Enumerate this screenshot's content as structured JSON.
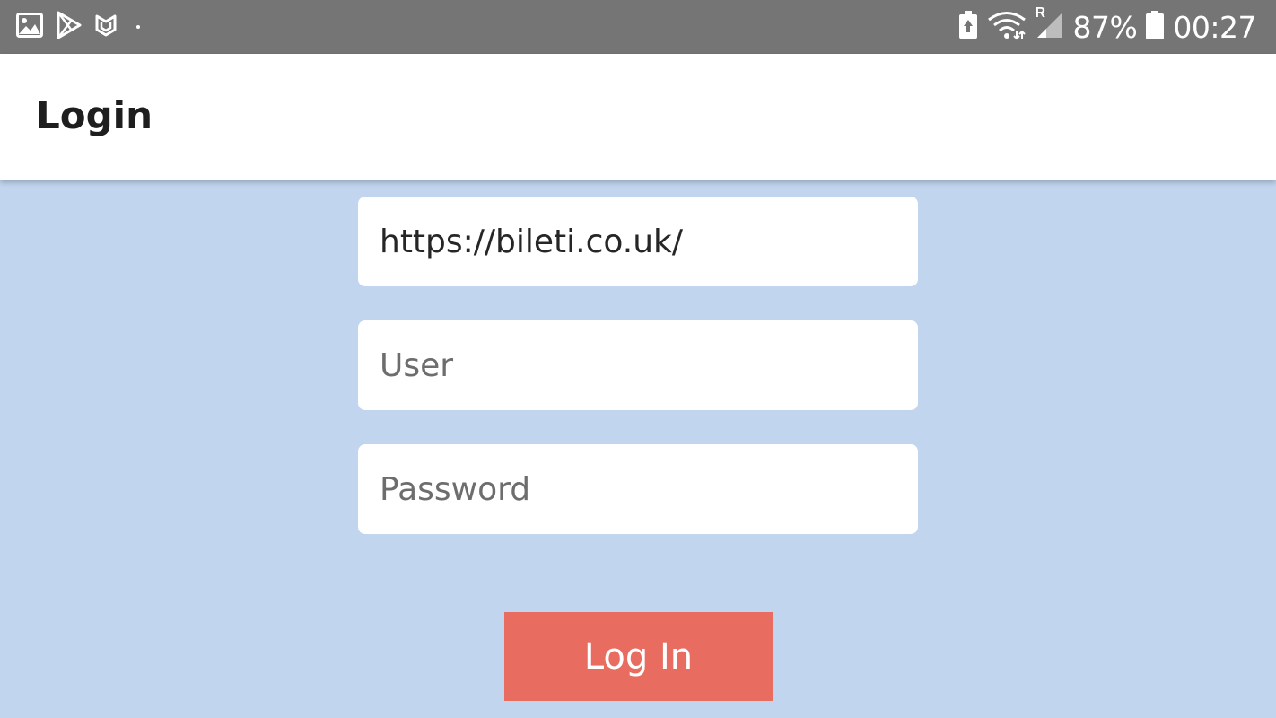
{
  "status_bar": {
    "battery_percent": "87%",
    "time": "00:27",
    "network_roaming_label": "R",
    "left_icons": [
      "image-icon",
      "play-store-icon",
      "mcafee-icon",
      "notification-dot"
    ],
    "right_icons": [
      "battery-saver-icon",
      "wifi-icon",
      "signal-icon",
      "battery-icon"
    ]
  },
  "app_bar": {
    "title": "Login"
  },
  "form": {
    "url": {
      "value": "https://bileti.co.uk/",
      "placeholder": ""
    },
    "user": {
      "value": "",
      "placeholder": "User"
    },
    "password": {
      "value": "",
      "placeholder": "Password"
    },
    "submit_label": "Log In"
  },
  "colors": {
    "background": "#c2d5ef",
    "status_bar": "#757575",
    "app_bar": "#ffffff",
    "button": "#e86c60"
  }
}
